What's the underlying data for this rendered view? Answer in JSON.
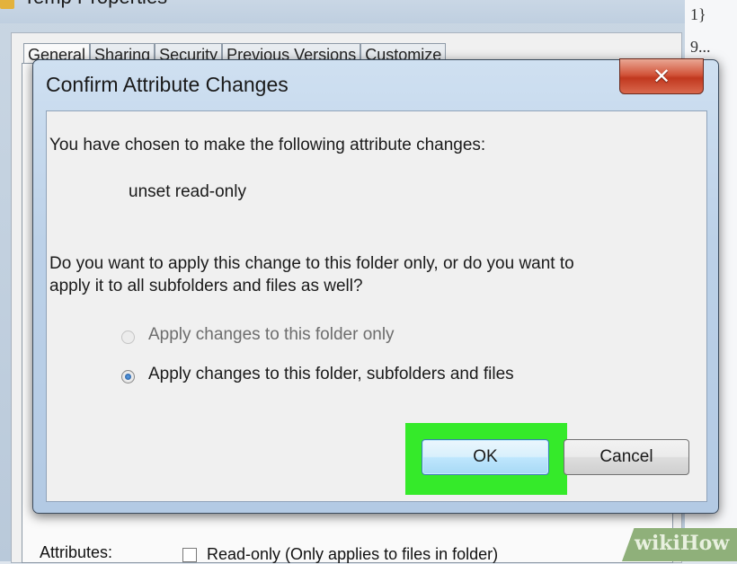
{
  "background_window": {
    "title": "Temp Properties",
    "tabs": [
      "General",
      "Sharing",
      "Security",
      "Previous Versions",
      "Customize"
    ],
    "right_column": [
      "1}",
      "9..."
    ],
    "attributes_label": "Attributes:",
    "readonly_label": "Read-only (Only applies to files in folder)"
  },
  "dialog": {
    "title": "Confirm Attribute Changes",
    "close_glyph": "✕",
    "intro": "You have chosen to make the following attribute changes:",
    "change": "unset read-only",
    "question_line1": "Do you want to apply this change to this folder only, or do you want to",
    "question_line2": "apply it to all subfolders and files as well?",
    "options": [
      {
        "label": "Apply changes to this folder only",
        "selected": false,
        "enabled": false
      },
      {
        "label": "Apply changes to this folder, subfolders and files",
        "selected": true,
        "enabled": true
      }
    ],
    "ok_label": "OK",
    "cancel_label": "Cancel"
  },
  "highlight_color": "#35ea2a",
  "watermark": "wikiHow"
}
